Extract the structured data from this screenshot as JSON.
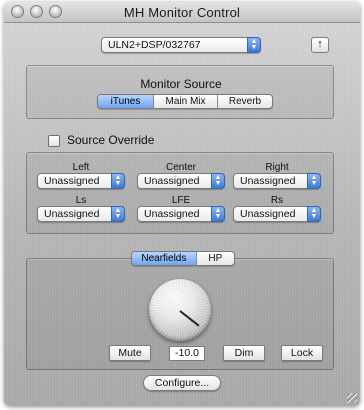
{
  "window": {
    "title": "MH Monitor Control"
  },
  "device": {
    "selected": "ULN2+DSP/032767",
    "upload_icon": "↑"
  },
  "monitor_source": {
    "label": "Monitor Source",
    "tabs": [
      "iTunes",
      "Main Mix",
      "Reverb"
    ],
    "active": "iTunes"
  },
  "source_override": {
    "label": "Source Override",
    "checked": false
  },
  "channels": [
    {
      "label": "Left",
      "value": "Unassigned"
    },
    {
      "label": "Center",
      "value": "Unassigned"
    },
    {
      "label": "Right",
      "value": "Unassigned"
    },
    {
      "label": "Ls",
      "value": "Unassigned"
    },
    {
      "label": "LFE",
      "value": "Unassigned"
    },
    {
      "label": "Rs",
      "value": "Unassigned"
    }
  ],
  "output": {
    "tabs": [
      "Nearfields",
      "HP"
    ],
    "active": "Nearfields",
    "level": "-10.0",
    "mute_label": "Mute",
    "dim_label": "Dim",
    "lock_label": "Lock"
  },
  "configure_label": "Configure...",
  "colors": {
    "accent": "#6fa4ef",
    "popup_arrow": "#3f79d6"
  }
}
